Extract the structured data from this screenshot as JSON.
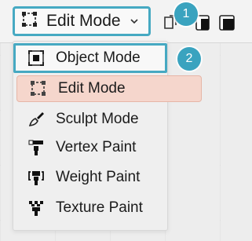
{
  "header": {
    "mode_select": {
      "label": "Edit Mode",
      "icon": "edit-mode-icon",
      "chevron": "chevron-down-icon"
    },
    "annotations": {
      "badge_1": "1",
      "badge_2": "2"
    },
    "right_icons": [
      "select-box-icon",
      "select-extend-icon",
      "select-subtract-icon"
    ]
  },
  "menu": {
    "items": [
      {
        "id": "object",
        "label": "Object Mode",
        "icon": "object-mode-icon"
      },
      {
        "id": "edit",
        "label": "Edit Mode",
        "icon": "edit-mode-icon"
      },
      {
        "id": "sculpt",
        "label": "Sculpt Mode",
        "icon": "sculpt-brush-icon"
      },
      {
        "id": "vertex",
        "label": "Vertex Paint",
        "icon": "vertex-paint-icon"
      },
      {
        "id": "weight",
        "label": "Weight Paint",
        "icon": "weight-paint-icon"
      },
      {
        "id": "texture",
        "label": "Texture Paint",
        "icon": "texture-paint-icon"
      }
    ]
  },
  "colors": {
    "highlight_border": "#46a9c2",
    "badge": "#3aa3bf",
    "selected_bg": "#f5d6cc"
  }
}
